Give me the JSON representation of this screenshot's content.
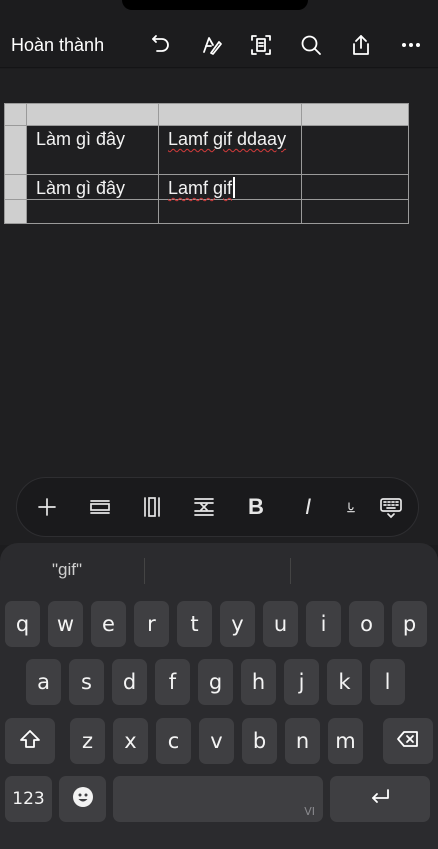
{
  "toolbar": {
    "done_label": "Hoàn thành",
    "icons": [
      "undo-icon",
      "pen-icon",
      "scan-text-icon",
      "search-icon",
      "share-icon",
      "more-icon"
    ]
  },
  "table": {
    "rows": [
      [
        "Làm gì đây",
        "Lamf gif ddaay",
        ""
      ],
      [
        "Làm gì đây",
        "Lamf gif",
        ""
      ],
      [
        "",
        "",
        ""
      ]
    ]
  },
  "format_bar": {
    "bold_label": "B",
    "italic_label": "I",
    "icons": [
      "plus-icon",
      "insert-row-icon",
      "insert-column-icon",
      "delete-row-icon",
      "bold-icon",
      "italic-icon",
      "underline-icon",
      "keyboard-dismiss-icon"
    ]
  },
  "keyboard": {
    "suggestion": "\"gif\"",
    "row1": [
      "q",
      "w",
      "e",
      "r",
      "t",
      "y",
      "u",
      "i",
      "o",
      "p"
    ],
    "row2": [
      "a",
      "s",
      "d",
      "f",
      "g",
      "h",
      "j",
      "k",
      "l"
    ],
    "row3": [
      "z",
      "x",
      "c",
      "v",
      "b",
      "n",
      "m"
    ],
    "numbers_label": "123",
    "space_lang": "VI"
  }
}
